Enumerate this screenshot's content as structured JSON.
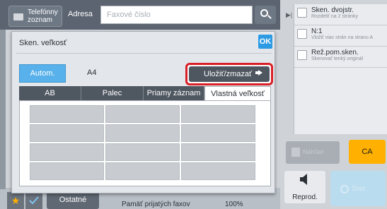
{
  "header": {
    "phonebook_label": "Telefónny zoznam",
    "address_label": "Adresa",
    "fax_placeholder": "Faxové číslo",
    "search_icon": "search-icon"
  },
  "right_panel": {
    "items": [
      {
        "title": "Sken. dvojstr.",
        "subtitle": "Rozdeliť na 2 stránky"
      },
      {
        "title": "N:1",
        "subtitle": "Vložiť viac strán na stranu A"
      },
      {
        "title": "Rež.pom.sken.",
        "subtitle": "Skenovať tenký originál"
      }
    ],
    "disabled_btn_label": "Náhľad",
    "ca_label": "CA",
    "reprod_label": "Reprod.",
    "start_label": "Štart"
  },
  "bottom": {
    "star_icon": "star-icon",
    "check_icon": "check-icon",
    "other_label": "Ostatné",
    "memory_label": "Pamäť prijatých faxov",
    "memory_value": "100%"
  },
  "dialog": {
    "title": "Sken. veľkosť",
    "ok_label": "OK",
    "autom_label": "Autom.",
    "size_value": "A4",
    "save_label": "Uložiť/zmazať",
    "tabs": [
      "AB",
      "Palec",
      "Priamy záznam",
      "Vlastná veľkosť"
    ],
    "active_tab_index": 3,
    "grid_rows": 4,
    "grid_cols": 3
  },
  "colors": {
    "accent_blue": "#2d9be3",
    "highlight_red": "#d91f26",
    "ca_orange": "#ffb000"
  }
}
